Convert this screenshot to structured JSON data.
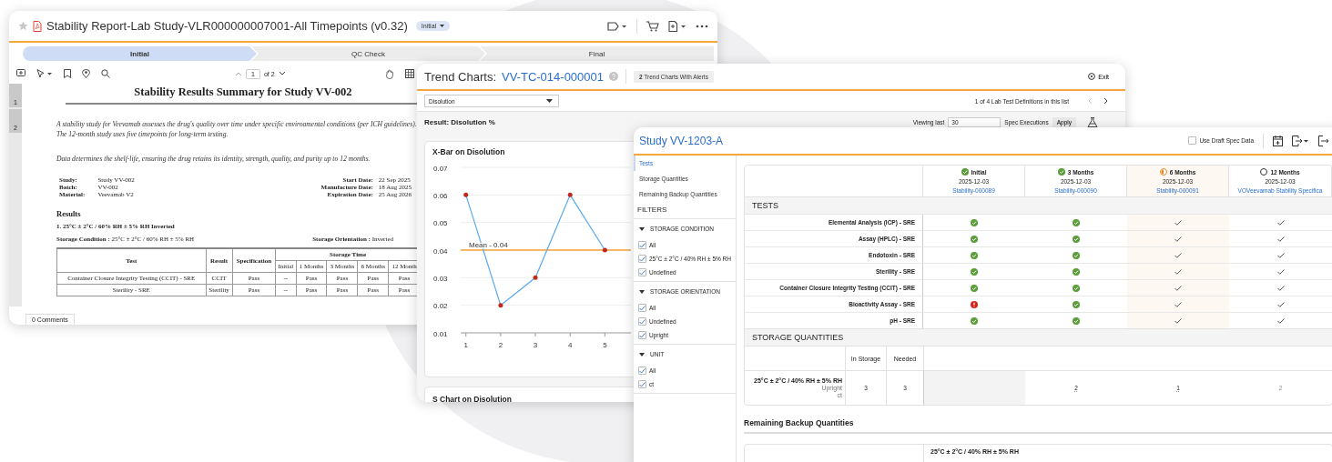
{
  "report_window": {
    "title": "Stability Report-Lab Study-VLR000000007001-All Timepoints (v0.32)",
    "state_badge": "Initial",
    "steps": [
      {
        "label": "Initial",
        "selected": true
      },
      {
        "label": "QC Check",
        "selected": false
      },
      {
        "label": "Final",
        "selected": false
      }
    ],
    "page_number": "1",
    "page_total": "of 2",
    "page_thumbnails": [
      "1",
      "2"
    ],
    "document": {
      "title": "Stability Results Summary for Study VV-002",
      "paragraphs": [
        "A stability study for Veevamab assesses the drug's quality over time under specific enviroamental conditions (per ICH guidelines). The 12-month study uses five timepoints for long-term testing.",
        "Data determines the shelf-life, ensuring the drug retains its identity, strength, quality, and purity up to 12 months."
      ],
      "info_left": [
        {
          "label": "Study:",
          "value": "Study VV-002"
        },
        {
          "label": "Batch:",
          "value": "VV-002"
        },
        {
          "label": "Material:",
          "value": "Veevamab V2"
        }
      ],
      "info_right": [
        {
          "label": "Start Date:",
          "value": "22 Sep 2025"
        },
        {
          "label": "Manufacture Date:",
          "value": "18 Aug 2025"
        },
        {
          "label": "Expiration Date:",
          "value": "25 Aug 2026"
        }
      ],
      "results_heading": "Results",
      "condition_heading": "1. 25°C ± 2°C / 60% RH ± 5% RH Inverted",
      "storage_condition": {
        "label": "Storage Condition :",
        "value": "25°C ± 2°C / 60% RH ± 5% RH"
      },
      "storage_orientation": {
        "label": "Storage Orientation :",
        "value": "Inverted"
      },
      "table": {
        "columns": [
          "Test",
          "Result",
          "Specification"
        ],
        "group_label": "Storage Time",
        "time_columns": [
          "Initial",
          "1 Months",
          "3 Months",
          "6 Months",
          "12 Month"
        ],
        "rows": [
          [
            "Container Closure Integrity Testing (CCIT) - SRE",
            "CCIT",
            "Pass",
            "--",
            "Pass",
            "Pass",
            "Pass",
            "Pass"
          ],
          [
            "Sterility - SRE",
            "Sterility",
            "Pass",
            "--",
            "Pass",
            "Pass",
            "Pass",
            "Pass"
          ]
        ]
      }
    },
    "comments_tab": "0 Comments"
  },
  "trend_window": {
    "title": "Trend Charts:",
    "record_id": "VV-TC-014-000001",
    "alerts_badge": {
      "count": "2",
      "label": "Trend Charts With Alerts"
    },
    "exit_label": "Exit",
    "test_select": "Disolution",
    "pager_text": "1 of 4 Lab Test Definitions in this list",
    "result_label": "Result: Disolution %",
    "viewing_label": "Viewing last",
    "viewing_value": "30",
    "executions_label": "Spec Executions",
    "apply_label": "Apply",
    "xbar_chart": {
      "chart_data": {
        "type": "line",
        "title": "X-Bar on Disolution",
        "x": [
          1,
          2,
          3,
          4,
          5
        ],
        "series": [
          {
            "color": "#5aaaf0",
            "values": [
              0.06,
              0.02,
              0.03,
              0.06,
              0.04
            ]
          }
        ],
        "xlim": [
          0.85,
          5.75
        ],
        "ylim": [
          0.01,
          0.07
        ],
        "xticks": [
          1,
          2,
          3,
          4,
          5
        ],
        "yticks": [
          0.01,
          0.02,
          0.03,
          0.04,
          0.05,
          0.06,
          0.07
        ],
        "grid": true,
        "ref_lines": [
          {
            "axis": "y",
            "value": 0.04,
            "label": "Mean - 0.04",
            "color": "#f4a23a"
          }
        ]
      }
    },
    "s_chart_title": "S Chart on Disolution"
  },
  "study_window": {
    "title": "Study VV-1203-A",
    "draft_spec": {
      "label": "Use Draft Spec Data",
      "checked": false
    },
    "nav": [
      {
        "label": "Tests",
        "selected": true
      },
      {
        "label": "Storage Quantities",
        "selected": false
      },
      {
        "label": "Remaining Backup Quantities",
        "selected": false
      }
    ],
    "filters_heading": "FILTERS",
    "filter_groups": [
      {
        "label": "STORAGE CONDITION",
        "expanded": true,
        "options": [
          {
            "label": "All",
            "checked": true
          },
          {
            "label": "25°C ± 2°C / 40% RH ± 5% RH",
            "checked": true
          },
          {
            "label": "Undefined",
            "checked": true
          }
        ]
      },
      {
        "label": "STORAGE ORIENTATION",
        "expanded": true,
        "options": [
          {
            "label": "All",
            "checked": true
          },
          {
            "label": "Undefined",
            "checked": true
          },
          {
            "label": "Upright",
            "checked": true
          }
        ]
      },
      {
        "label": "UNIT",
        "expanded": true,
        "options": [
          {
            "label": "All",
            "checked": true
          },
          {
            "label": "ct",
            "checked": true
          }
        ]
      }
    ],
    "timepoints": [
      {
        "label": "Initial",
        "kind": "complete",
        "date": "2025-12-03",
        "link": "Stability-000089"
      },
      {
        "label": "3 Months",
        "kind": "complete",
        "date": "2025-12-03",
        "link": "Stability-000090"
      },
      {
        "label": "6 Months",
        "kind": "progress",
        "date": "2025-12-03",
        "link": "Stability-000091"
      },
      {
        "label": "12 Months",
        "kind": "pending",
        "date": "2025-12-03",
        "link": "VOVeevamab Stability Specifica"
      }
    ],
    "tests_heading": "TESTS",
    "tests": [
      {
        "name": "Elemental Analysis (ICP) - SRE",
        "results": [
          {
            "kind": "pass"
          },
          {
            "kind": "pass"
          },
          {
            "kind": "check"
          },
          {
            "kind": "check"
          }
        ]
      },
      {
        "name": "Assay (HPLC) - SRE",
        "results": [
          {
            "kind": "pass"
          },
          {
            "kind": "pass"
          },
          {
            "kind": "check"
          },
          {
            "kind": "check"
          }
        ]
      },
      {
        "name": "Endotoxin - SRE",
        "results": [
          {
            "kind": "pass"
          },
          {
            "kind": "pass"
          },
          {
            "kind": "check"
          },
          {
            "kind": "check"
          }
        ]
      },
      {
        "name": "Sterility - SRE",
        "results": [
          {
            "kind": "pass"
          },
          {
            "kind": "pass"
          },
          {
            "kind": "check"
          },
          {
            "kind": "check"
          }
        ]
      },
      {
        "name": "Container Closure Integrity Testing (CCIT) - SRE",
        "results": [
          {
            "kind": "pass"
          },
          {
            "kind": "pass"
          },
          {
            "kind": "check"
          },
          {
            "kind": "check"
          }
        ]
      },
      {
        "name": "Bioactivity Assay - SRE",
        "results": [
          {
            "kind": "fail"
          },
          {
            "kind": "pass"
          },
          {
            "kind": "check"
          },
          {
            "kind": "check"
          }
        ]
      },
      {
        "name": "pH - SRE",
        "results": [
          {
            "kind": "pass"
          },
          {
            "kind": "pass"
          },
          {
            "kind": "check"
          },
          {
            "kind": "check"
          }
        ]
      }
    ],
    "storage_heading": "STORAGE QUANTITIES",
    "storage_columns": [
      "In Storage",
      "Needed"
    ],
    "storage_rows": [
      {
        "condition": "25°C ± 2°C / 40% RH ± 5% RH",
        "orientation": "Upright",
        "unit": "ct",
        "in_storage": "3",
        "needed": "3",
        "timepoints": [
          {
            "shaded": true
          },
          {
            "value": "2",
            "muted": false
          },
          {
            "value": "1",
            "muted": false
          },
          {
            "value": "2",
            "muted": true
          }
        ]
      }
    ],
    "backup_heading": "Remaining Backup Quantities",
    "backup_columns": [
      "25°C ± 2°C / 40% RH ± 5% RH"
    ]
  }
}
